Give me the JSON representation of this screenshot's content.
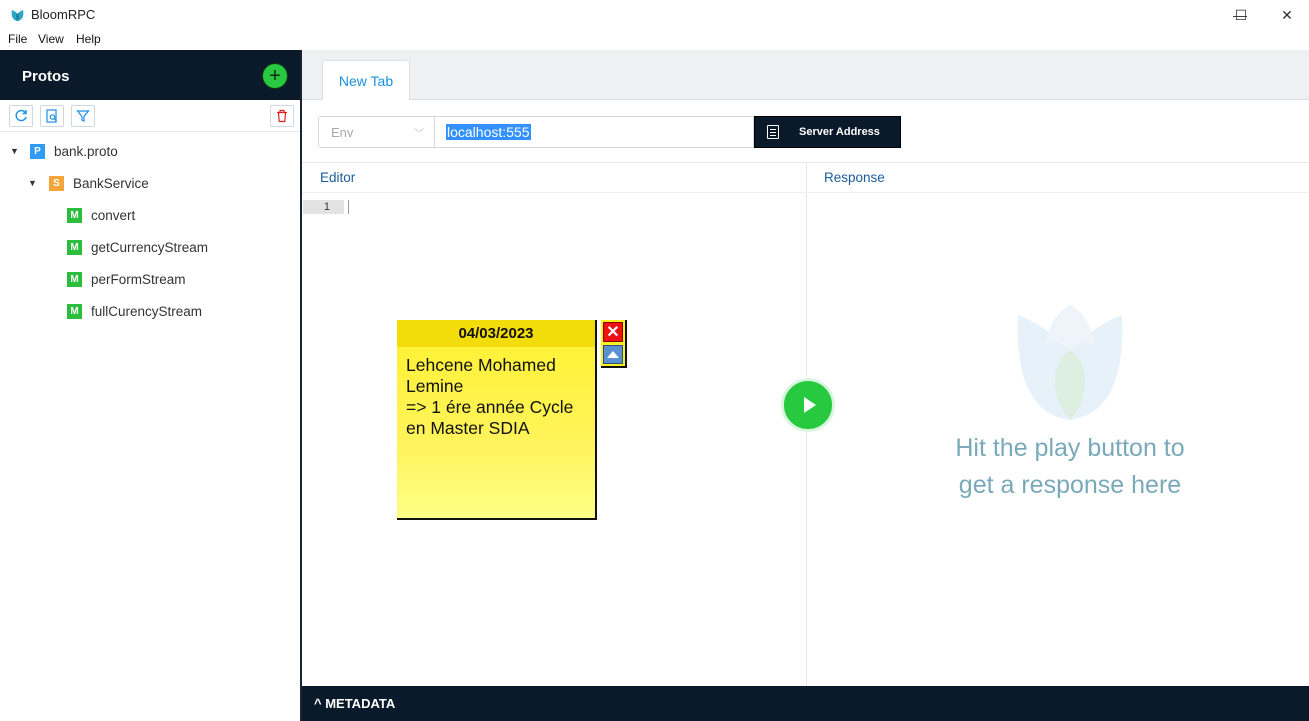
{
  "window": {
    "title": "BloomRPC",
    "minimize": "—",
    "maximize": "☐",
    "close": "✕"
  },
  "menu": [
    "File",
    "View",
    "Help"
  ],
  "sidebar": {
    "title": "Protos",
    "add_icon": "plus-icon",
    "tools": [
      "refresh-icon",
      "search-file-icon",
      "filter-icon",
      "trash-icon"
    ],
    "tree": {
      "proto": {
        "badge": "P",
        "label": "bank.proto"
      },
      "service": {
        "badge": "S",
        "label": "BankService"
      },
      "methods": [
        {
          "badge": "M",
          "label": "convert"
        },
        {
          "badge": "M",
          "label": "getCurrencyStream"
        },
        {
          "badge": "M",
          "label": "perFormStream"
        },
        {
          "badge": "M",
          "label": "fullCurencyStream"
        }
      ]
    }
  },
  "tabs": [
    {
      "label": "New Tab"
    }
  ],
  "address_bar": {
    "env_placeholder": "Env",
    "address_value": "localhost:555",
    "server_button": "Server Address"
  },
  "editor": {
    "header": "Editor",
    "line_number": "1"
  },
  "response": {
    "header": "Response",
    "hint": "Hit the play button to get a response here"
  },
  "metadata": {
    "label": "^ METADATA"
  },
  "sticky_note": {
    "date": "04/03/2023",
    "text": "Lehcene Mohamed\nLemine\n=> 1 ére année Cycle\nen Master SDIA",
    "close_label": "✕"
  },
  "colors": {
    "nav_dark": "#0b1a2b",
    "accent_green": "#27c93f",
    "tab_blue": "#1b8fe2",
    "hint_teal": "#7aa9b9"
  }
}
